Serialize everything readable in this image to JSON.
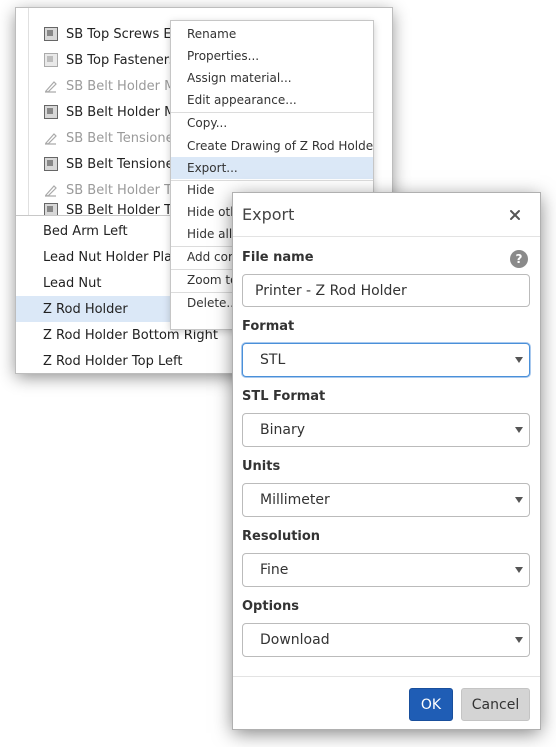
{
  "tree": {
    "items": [
      {
        "label": "SB Top Screws Ex",
        "icon": "part-icon",
        "faded": false
      },
      {
        "label": "SB Top Fasteners",
        "icon": "part-faded-icon",
        "faded": false
      },
      {
        "label": "SB Belt Holder Ma",
        "icon": "sketch-icon",
        "faded": true
      },
      {
        "label": "SB Belt Holder Ma",
        "icon": "part-icon",
        "faded": false
      },
      {
        "label": "SB Belt Tensioner",
        "icon": "sketch-icon",
        "faded": true
      },
      {
        "label": "SB Belt Tensioner",
        "icon": "part-icon",
        "faded": false
      },
      {
        "label": "SB Belt Holder Te",
        "icon": "sketch-icon",
        "faded": true
      },
      {
        "label": "SB Belt Holder Te",
        "icon": "part-icon",
        "faded": false
      }
    ]
  },
  "part_list": {
    "items": [
      "Bed Arm Left",
      "Lead Nut Holder Plate",
      "Lead Nut",
      "Z Rod Holder",
      "Z Rod Holder Bottom Right",
      "Z Rod Holder Top Left"
    ],
    "selected": "Z Rod Holder"
  },
  "context_menu": {
    "items": [
      "Rename",
      "Properties...",
      "Assign material...",
      "Edit appearance...",
      "Copy...",
      "Create Drawing of Z Rod Holder...",
      "Export...",
      "Hide",
      "Hide othe",
      "Hide all p",
      "Add com",
      "Zoom to",
      "Delete..."
    ],
    "highlighted": "Export..."
  },
  "dialog": {
    "title": "Export",
    "file_name_label": "File name",
    "file_name_value": "Printer - Z Rod Holder",
    "format_label": "Format",
    "format_value": "STL",
    "stl_format_label": "STL Format",
    "stl_format_value": "Binary",
    "units_label": "Units",
    "units_value": "Millimeter",
    "resolution_label": "Resolution",
    "resolution_value": "Fine",
    "options_label": "Options",
    "options_value": "Download",
    "help_glyph": "?",
    "ok_label": "OK",
    "cancel_label": "Cancel"
  },
  "colors": {
    "accent": "#1f5db5",
    "selection": "#dbe8f7",
    "focus": "#4a90d9"
  }
}
